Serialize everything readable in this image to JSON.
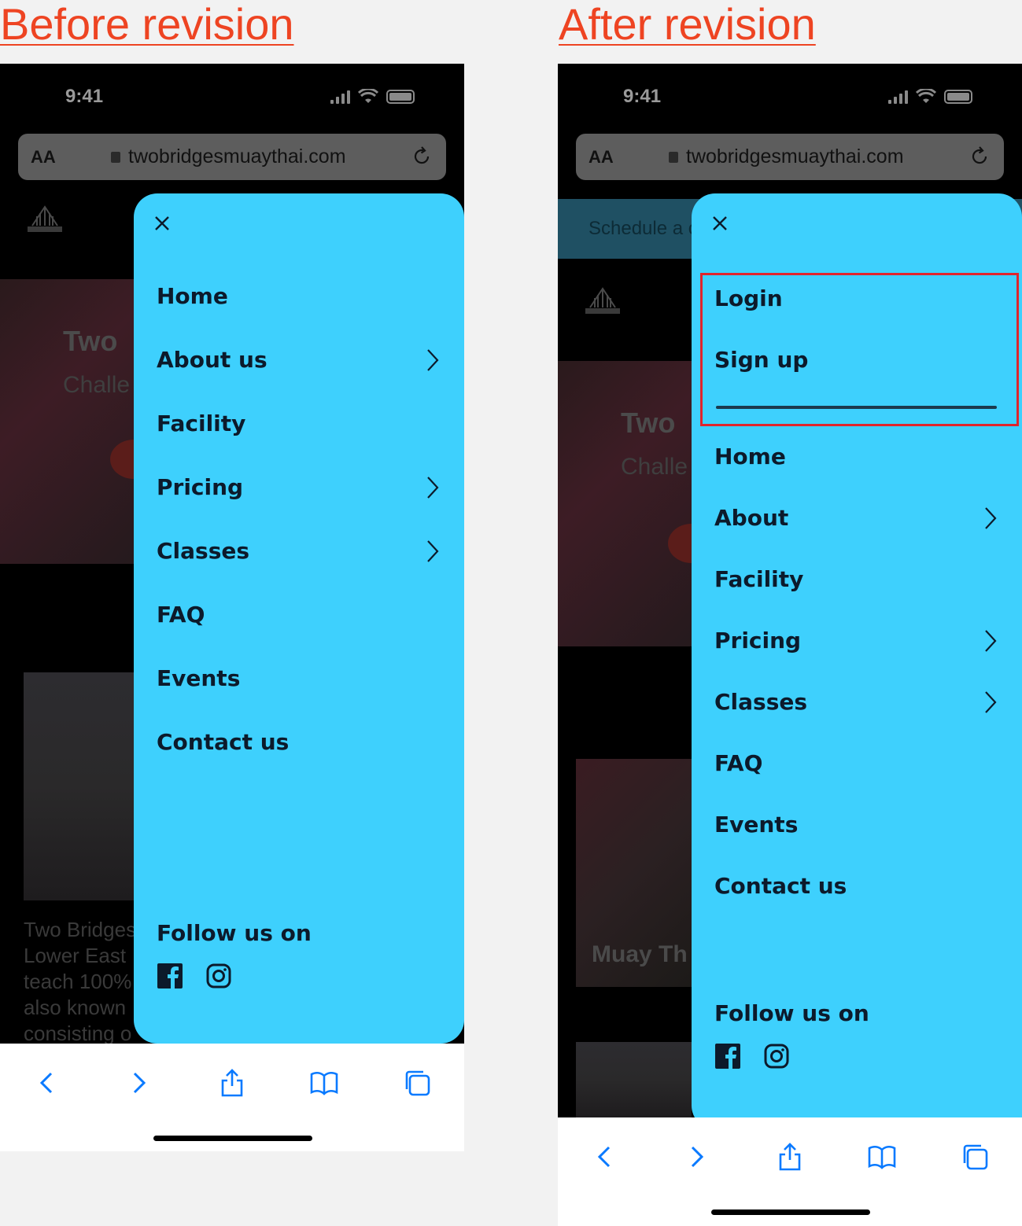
{
  "headings": {
    "before": "Before revision",
    "after": "After revision"
  },
  "status": {
    "time": "9:41"
  },
  "browser": {
    "aa": "AA",
    "url": "twobridgesmuaythai.com"
  },
  "background": {
    "hero_title": "Two",
    "hero_sub": "Challe",
    "body_lines": [
      "Two Bridges",
      "Lower East",
      "teach 100%",
      "also known",
      "consisting o"
    ],
    "schedule": "Schedule a c",
    "video_caption": "Muay Th"
  },
  "before_menu": {
    "items": [
      {
        "label": "Home",
        "chevron": false
      },
      {
        "label": "About us",
        "chevron": true
      },
      {
        "label": "Facility",
        "chevron": false
      },
      {
        "label": "Pricing",
        "chevron": true
      },
      {
        "label": "Classes",
        "chevron": true
      },
      {
        "label": "FAQ",
        "chevron": false
      },
      {
        "label": "Events",
        "chevron": false
      },
      {
        "label": "Contact us",
        "chevron": false
      }
    ],
    "follow": "Follow us on"
  },
  "after_menu": {
    "auth": [
      {
        "label": "Login"
      },
      {
        "label": "Sign up"
      }
    ],
    "items": [
      {
        "label": "Home",
        "chevron": false
      },
      {
        "label": "About",
        "chevron": true
      },
      {
        "label": "Facility",
        "chevron": false
      },
      {
        "label": "Pricing",
        "chevron": true
      },
      {
        "label": "Classes",
        "chevron": true
      },
      {
        "label": "FAQ",
        "chevron": false
      },
      {
        "label": "Events",
        "chevron": false
      },
      {
        "label": "Contact us",
        "chevron": false
      }
    ],
    "follow": "Follow us on"
  },
  "icons": [
    "close-icon",
    "chevron-right-icon",
    "facebook-icon",
    "instagram-icon",
    "back-icon",
    "forward-icon",
    "share-icon",
    "bookmarks-icon",
    "tabs-icon",
    "reload-icon",
    "lock-icon"
  ],
  "colors": {
    "menu_bg": "#3ed0fd",
    "heading": "#ee4422",
    "highlight": "#e0242c",
    "menu_text": "#0c1a2b",
    "toolbar_icon": "#0a7aff"
  }
}
